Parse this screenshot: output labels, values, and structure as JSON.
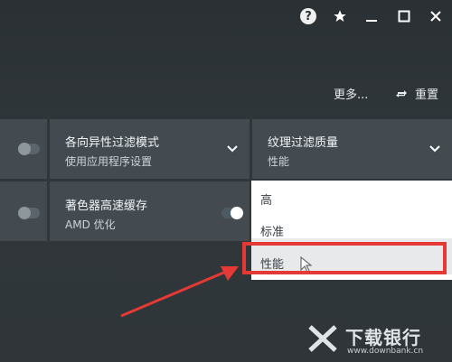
{
  "toolbar": {
    "more_label": "更多...",
    "reset_label": "重置"
  },
  "settings": {
    "anisotropic": {
      "title": "各向异性过滤模式",
      "value": "使用应用程序设置"
    },
    "texture_quality": {
      "title": "纹理过滤质量",
      "value": "性能"
    },
    "shader_cache": {
      "title": "著色器高速缓存",
      "value": "AMD 优化"
    }
  },
  "dropdown": {
    "options": [
      "高",
      "标准",
      "性能"
    ],
    "selected": "性能"
  },
  "watermark": {
    "name": "下载银行",
    "url": "www.downbank.cn"
  },
  "colors": {
    "background": "#2f3539",
    "card": "#434b51",
    "dropdown_bg": "#ffffff",
    "dropdown_selected_bg": "#e7e9ea",
    "annotation_red": "#e53935"
  },
  "icons": [
    "help-icon",
    "star-icon",
    "minimize-icon",
    "maximize-icon",
    "close-icon",
    "reset-icon",
    "chevron-down-icon",
    "cursor-icon",
    "arrow-annotation"
  ]
}
